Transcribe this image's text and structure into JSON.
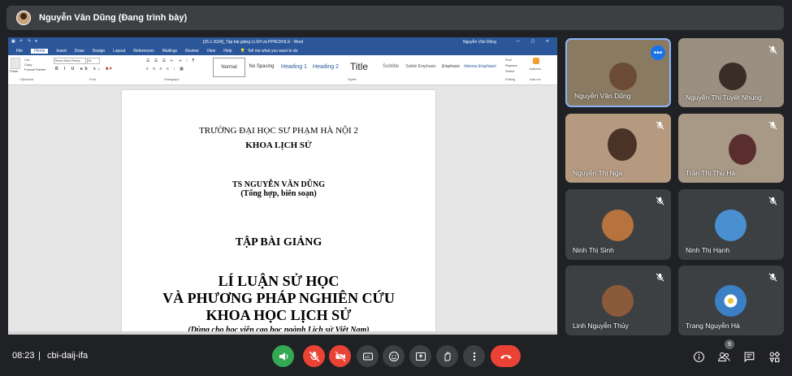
{
  "presenter": {
    "name": "Nguyễn Văn Dũng (Đang trình bày)"
  },
  "word": {
    "title": "[25.1.2024]_Tập bài giảng LLSH và PPNCKHLS - Word",
    "user": "Nguyễn Văn Dũng",
    "tell_me": "Tell me what you want to do",
    "menu": [
      "File",
      "Home",
      "Insert",
      "Draw",
      "Design",
      "Layout",
      "References",
      "Mailings",
      "Review",
      "View",
      "Help"
    ],
    "font_name": "Times New Roma",
    "font_size": "16",
    "styles": [
      "Normal",
      "No Spacing",
      "Heading 1",
      "Heading 2",
      "Title",
      "Subtitle",
      "Subtle Emphasis",
      "Emphasis",
      "Intense Emphasis"
    ],
    "editing": [
      "Find",
      "Replace",
      "Select"
    ],
    "groups": {
      "clipboard": "Clipboard",
      "font": "Font",
      "paragraph": "Paragraph",
      "styles": "Styles",
      "editing": "Editing",
      "addins": "Add-ins"
    },
    "clipboard": {
      "paste": "Paste",
      "cut": "Cut",
      "copy": "Copy",
      "format_painter": "Format Painter"
    },
    "addins_label": "Add-ins"
  },
  "document": {
    "line1": "TRƯỜNG ĐẠI HỌC SƯ PHẠM HÀ NỘI 2",
    "line2": "KHOA LỊCH SỬ",
    "author": "TS NGUYỄN VĂN DŨNG",
    "author_note": "(Tổng hợp, biên soạn)",
    "doc_type": "TẬP BÀI GIẢNG",
    "title1": "LÍ LUẬN SỬ HỌC",
    "title2": "VÀ PHƯƠNG PHÁP NGHIÊN CỨU",
    "title3": "KHOA HỌC LỊCH SỬ",
    "subtitle": "(Dùng cho học viên cao học ngành Lịch sử Việt Nam)"
  },
  "participants": [
    {
      "name": "Nguyễn Văn Dũng"
    },
    {
      "name": "Nguyễn Thị Tuyết Nhung"
    },
    {
      "name": "Nguyễn Thị Nga"
    },
    {
      "name": "Trần Thị Thu Hà"
    },
    {
      "name": "Ninh Thị Sinh"
    },
    {
      "name": "Ninh Thị Hạnh"
    },
    {
      "name": "Linh Nguyễn Thủy"
    },
    {
      "name": "Trang Nguyễn Hà"
    }
  ],
  "bottom": {
    "time": "08:23",
    "separator": "|",
    "meeting_code": "cbi-daij-ifa",
    "people_count": "9"
  },
  "colors": {
    "background": "#202124",
    "tile": "#3c4043",
    "end_call": "#ea4335",
    "captions_green": "#34a853",
    "word_blue": "#2b579a"
  }
}
